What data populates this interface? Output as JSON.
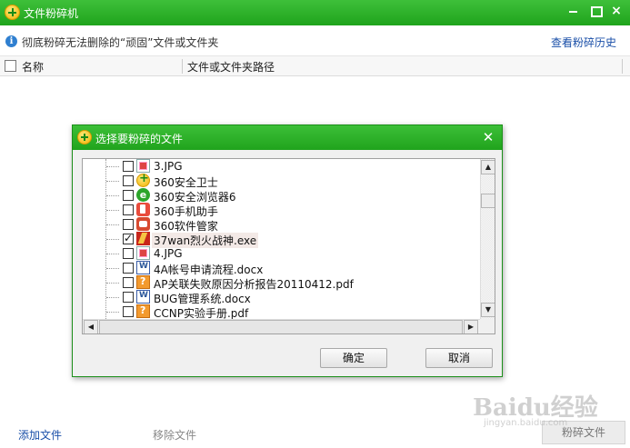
{
  "window": {
    "title": "文件粉碎机",
    "close_glyph": "×"
  },
  "infobar": {
    "text": "彻底粉碎无法删除的“顽固”文件或文件夹",
    "history_link": "查看粉碎历史",
    "info_glyph": "i"
  },
  "list_header": {
    "name": "名称",
    "path": "文件或文件夹路径"
  },
  "bottom": {
    "add": "添加文件",
    "remove": "移除文件",
    "shred": "粉碎文件"
  },
  "watermark": {
    "text": "Baidu经验",
    "sub": "jingyan.baidu.com"
  },
  "dialog": {
    "title": "选择要粉碎的文件",
    "close_glyph": "✕",
    "ok": "确定",
    "cancel": "取消",
    "files": [
      {
        "name": "3.JPG",
        "icon": "image-icon",
        "checked": false
      },
      {
        "name": "360安全卫士",
        "icon": "360-safe-icon",
        "checked": false
      },
      {
        "name": "360安全浏览器6",
        "icon": "browser-icon",
        "checked": false
      },
      {
        "name": "360手机助手",
        "icon": "phone-assistant-icon",
        "checked": false
      },
      {
        "name": "360软件管家",
        "icon": "software-manager-icon",
        "checked": false
      },
      {
        "name": "37wan烈火战神.exe",
        "icon": "exe-icon",
        "checked": true
      },
      {
        "name": "4.JPG",
        "icon": "image-icon",
        "checked": false
      },
      {
        "name": "4A帐号申请流程.docx",
        "icon": "word-doc-icon",
        "checked": false
      },
      {
        "name": "AP关联失败原因分析报告20110412.pdf",
        "icon": "pdf-icon",
        "checked": false
      },
      {
        "name": "BUG管理系统.docx",
        "icon": "word-doc-icon",
        "checked": false
      },
      {
        "name": "CCNP实验手册.pdf",
        "icon": "pdf-icon",
        "checked": false
      }
    ],
    "ie_glyph": "e",
    "arrows": {
      "up": "▲",
      "down": "▼",
      "left": "◀",
      "right": "▶"
    }
  }
}
